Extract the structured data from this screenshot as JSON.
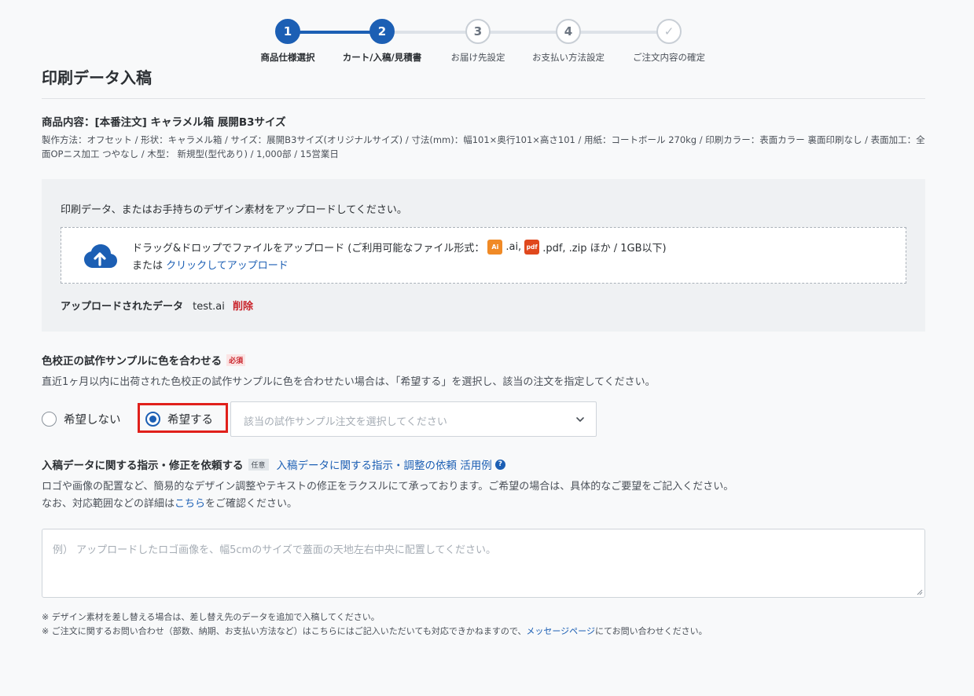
{
  "stepper": {
    "steps": [
      {
        "num": "1",
        "label": "商品仕様選択",
        "state": "active"
      },
      {
        "num": "2",
        "label": "カート/入稿/見積書",
        "state": "active"
      },
      {
        "num": "3",
        "label": "お届け先設定",
        "state": "pending"
      },
      {
        "num": "4",
        "label": "お支払い方法設定",
        "state": "pending"
      },
      {
        "num": "✓",
        "label": "ご注文内容の確定",
        "state": "pending"
      }
    ]
  },
  "page_title": "印刷データ入稿",
  "product": {
    "title": "商品内容：[本番注文] キャラメル箱 展開B3サイズ",
    "spec": "製作方法：オフセット / 形状：キャラメル箱 / サイズ：展開B3サイズ(オリジナルサイズ) / 寸法(mm)：幅101×奥行101×高さ101 / 用紙：コートボール 270kg / 印刷カラー：表面カラー 裏面印刷なし / 表面加工：全面OPニス加工 つやなし / 木型： 新規型(型代あり) / 1,000部 / 15営業日"
  },
  "upload": {
    "intro": "印刷データ、またはお手持ちのデザイン素材をアップロードしてください。",
    "drop_text": "ドラッグ&ドロップでファイルをアップロード (ご利用可能なファイル形式：",
    "ai_badge": "Ai",
    "ai_ext": ".ai,",
    "pdf_badge": "pdf",
    "rest_ext": ".pdf, .zip ほか / 1GB以下)",
    "or_text": "または",
    "click_link": "クリックしてアップロード",
    "uploaded_label": "アップロードされたデータ",
    "uploaded_file": "test.ai",
    "delete_label": "削除"
  },
  "color_match": {
    "title": "色校正の試作サンプルに色を合わせる",
    "required_badge": "必須",
    "desc": "直近1ヶ月以内に出荷された色校正の試作サンプルに色を合わせたい場合は、「希望する」を選択し、該当の注文を指定してください。",
    "option_no": "希望しない",
    "option_yes": "希望する",
    "selected": "希望する",
    "select_placeholder": "該当の試作サンプル注文を選択してください"
  },
  "instructions": {
    "title": "入稿データに関する指示・修正を依頼する",
    "optional_badge": "任意",
    "help_link": "入稿データに関する指示・調整の依頼 活用例",
    "desc1": "ロゴや画像の配置など、簡易的なデザイン調整やテキストの修正をラクスルにて承っております。ご希望の場合は、具体的なご要望をご記入ください。",
    "desc2_pre": "なお、対応範囲などの詳細は",
    "desc2_link": "こちら",
    "desc2_post": "をご確認ください。",
    "textarea_placeholder": "例） アップロードしたロゴ画像を、幅5cmのサイズで蓋面の天地左右中央に配置してください。"
  },
  "notes": {
    "note1": "※ デザイン素材を差し替える場合は、差し替え先のデータを追加で入稿してください。",
    "note2_pre": "※ ご注文に関するお問い合わせ（部数、納期、お支払い方法など）はこちらにはご記入いただいても対応できかねますので、",
    "note2_link": "メッセージページ",
    "note2_post": "にてお問い合わせください。"
  },
  "colors": {
    "primary": "#1c5fb4",
    "danger": "#c9242b",
    "highlight": "#e0201b"
  }
}
